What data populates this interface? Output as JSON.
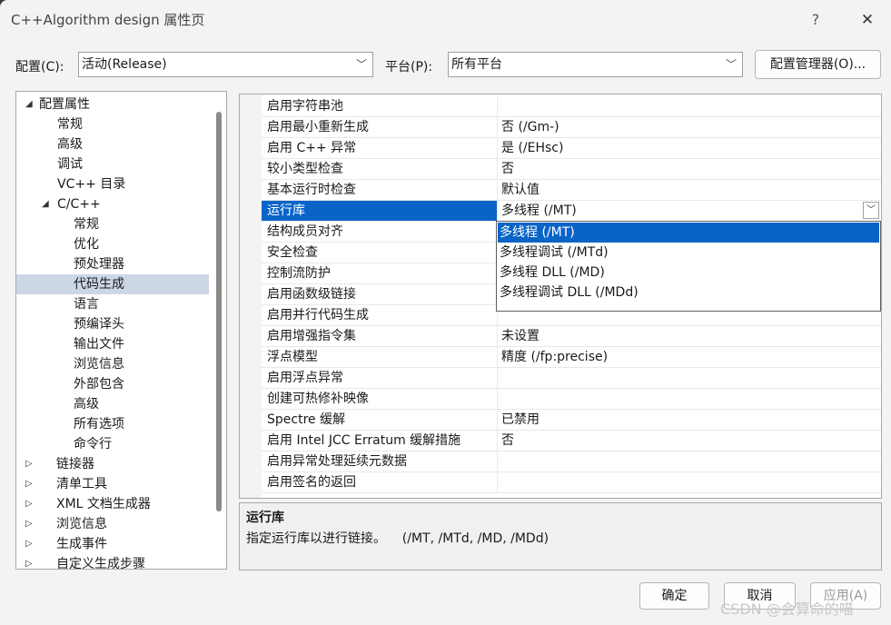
{
  "window": {
    "title": "C++Algorithm design 属性页",
    "help_label": "?",
    "close_label": "✕"
  },
  "toolbar": {
    "config_label": "配置(C):",
    "config_value": "活动(Release)",
    "platform_label": "平台(P):",
    "platform_value": "所有平台",
    "manager_button": "配置管理器(O)..."
  },
  "tree": {
    "items": [
      {
        "label": "配置属性",
        "toggle": "◢"
      },
      {
        "label": "常规"
      },
      {
        "label": "高级"
      },
      {
        "label": "调试"
      },
      {
        "label": "VC++ 目录"
      },
      {
        "label": "C/C++",
        "toggle": "◢"
      },
      {
        "label": "常规"
      },
      {
        "label": "优化"
      },
      {
        "label": "预处理器"
      },
      {
        "label": "代码生成"
      },
      {
        "label": "语言"
      },
      {
        "label": "预编译头"
      },
      {
        "label": "输出文件"
      },
      {
        "label": "浏览信息"
      },
      {
        "label": "外部包含"
      },
      {
        "label": "高级"
      },
      {
        "label": "所有选项"
      },
      {
        "label": "命令行"
      },
      {
        "label": "链接器",
        "toggle": "▷"
      },
      {
        "label": "清单工具",
        "toggle": "▷"
      },
      {
        "label": "XML 文档生成器",
        "toggle": "▷"
      },
      {
        "label": "浏览信息",
        "toggle": "▷"
      },
      {
        "label": "生成事件",
        "toggle": "▷"
      },
      {
        "label": "自定义生成步骤",
        "toggle": "▷"
      }
    ]
  },
  "properties": [
    {
      "name": "启用字符串池",
      "value": ""
    },
    {
      "name": "启用最小重新生成",
      "value": "否 (/Gm-)"
    },
    {
      "name": "启用 C++ 异常",
      "value": "是 (/EHsc)"
    },
    {
      "name": "较小类型检查",
      "value": "否"
    },
    {
      "name": "基本运行时检查",
      "value": "默认值"
    },
    {
      "name": "运行库",
      "value": "多线程 (/MT)"
    },
    {
      "name": "结构成员对齐",
      "value": ""
    },
    {
      "name": "安全检查",
      "value": ""
    },
    {
      "name": "控制流防护",
      "value": ""
    },
    {
      "name": "启用函数级链接",
      "value": ""
    },
    {
      "name": "启用并行代码生成",
      "value": ""
    },
    {
      "name": "启用增强指令集",
      "value": "未设置"
    },
    {
      "name": "浮点模型",
      "value": "精度 (/fp:precise)"
    },
    {
      "name": "启用浮点异常",
      "value": ""
    },
    {
      "name": "创建可热修补映像",
      "value": ""
    },
    {
      "name": "Spectre 缓解",
      "value": "已禁用"
    },
    {
      "name": "启用 Intel JCC Erratum 缓解措施",
      "value": "否"
    },
    {
      "name": "启用异常处理延续元数据",
      "value": ""
    },
    {
      "name": "启用签名的返回",
      "value": ""
    }
  ],
  "dropdown": {
    "options": [
      "多线程 (/MT)",
      "多线程调试 (/MTd)",
      "多线程 DLL (/MD)",
      "多线程调试 DLL (/MDd)"
    ]
  },
  "description": {
    "title": "运行库",
    "text": "指定运行库以进行链接。    (/MT, /MTd, /MD, /MDd)"
  },
  "buttons": {
    "ok": "确定",
    "cancel": "取消",
    "apply": "应用(A)"
  },
  "watermark": "CSDN @会算命的喵",
  "colors": {
    "selection": "#0a64c8",
    "tree_selection": "#ccd7e6"
  }
}
